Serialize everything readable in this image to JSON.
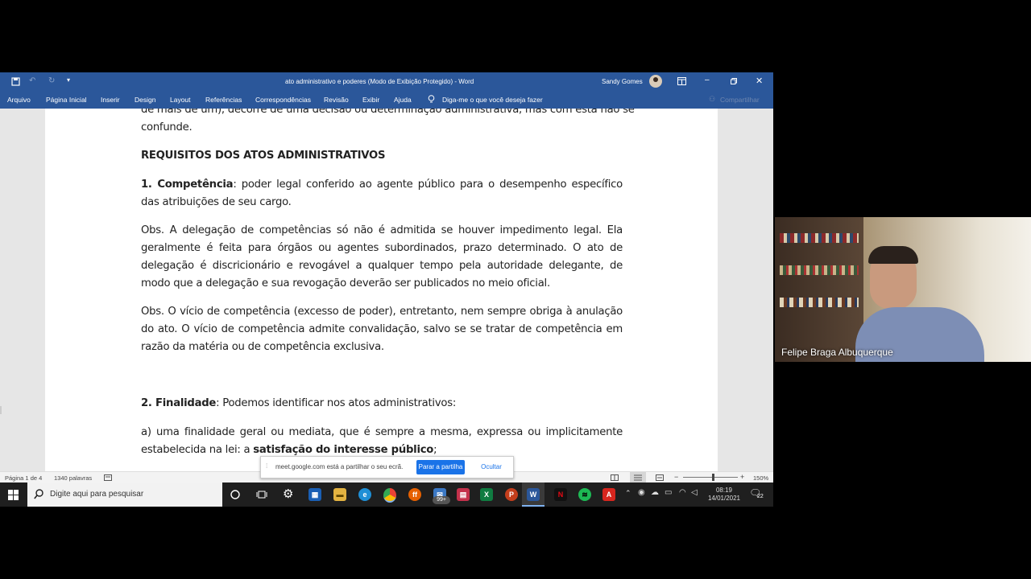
{
  "word": {
    "title": "ato administrativo e poderes (Modo de Exibição Protegido) - Word",
    "user": "Sandy Gomes",
    "tabs": [
      "Arquivo",
      "Página Inicial",
      "Inserir",
      "Design",
      "Layout",
      "Referências",
      "Correspondências",
      "Revisão",
      "Exibir",
      "Ajuda"
    ],
    "tell_me": "Diga-me o que você deseja fazer",
    "share": "Compartilhar"
  },
  "document": {
    "p0_line1": "de mais de um), decorre de uma decisão ou determinação administrativa, mas com esta não se",
    "p0_line2": "confunde.",
    "heading": "REQUISITOS DOS ATOS ADMINISTRATIVOS",
    "p1_bold": "1. Competência",
    "p1_rest": ": poder legal conferido ao agente público para o desempenho específico das atribuições de seu cargo.",
    "p2": "Obs. A delegação de competências só não é admitida se houver impedimento legal.  Ela geralmente é feita para órgãos ou agentes subordinados, prazo determinado. O ato de delegação é discricionário e revogável a qualquer tempo pela autoridade delegante, de modo que a delegação e sua revogação deverão ser publicados no meio oficial.",
    "p3": "Obs. O vício de competência (excesso de poder), entretanto, nem sempre obriga à anulação do ato. O vício de competência admite convalidação, salvo se se tratar de competência em razão da matéria ou de competência exclusiva.",
    "p4_bold": "2. Finalidade",
    "p4_rest": ": Podemos identificar nos atos administrativos:",
    "p5_plain": "a) uma finalidade geral ou mediata, que é sempre a mesma, expressa ou implicitamente estabelecida na lei: a ",
    "p5_bold": "satisfação do interesse público",
    "p5_end": ";"
  },
  "status": {
    "page": "Página 1 de 4",
    "words": "1340 palavras",
    "zoom": "150%"
  },
  "sharebar": {
    "text": "meet.google.com está a partilhar o seu ecrã.",
    "stop": "Parar a partilha",
    "hide": "Ocultar"
  },
  "taskbar": {
    "search_placeholder": "Digite aqui para pesquisar",
    "time": "08:19",
    "date": "14/01/2021",
    "notifications": "22",
    "mail_badge": "99+"
  },
  "video": {
    "participant": "Felipe Braga Albuquerque"
  },
  "colors": {
    "word_blue": "#2b579a",
    "meet_blue": "#1a73e8",
    "taskbar": "#1f1f1f"
  }
}
